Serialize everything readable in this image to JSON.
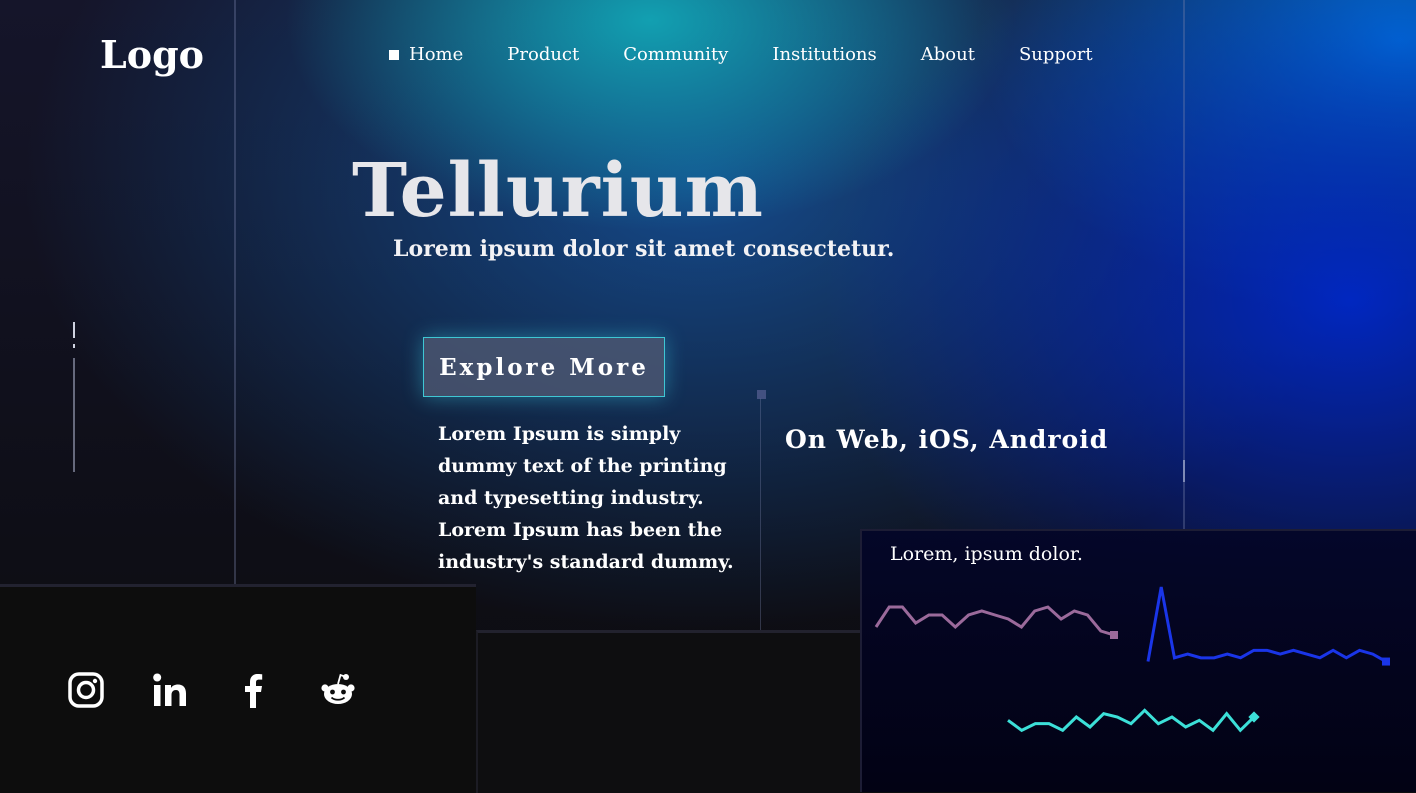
{
  "header": {
    "logo": "Logo",
    "nav": [
      "Home",
      "Product",
      "Community",
      "Institutions",
      "About",
      "Support"
    ]
  },
  "hero": {
    "title": "Tellurium",
    "subtitle": "Lorem ipsum dolor sit amet consectetur.",
    "cta_label": "Explore More",
    "description": "Lorem Ipsum is simply dummy text of the printing and typesetting industry. Lorem Ipsum has been the industry's standard dummy.",
    "platforms": "On Web, iOS, Android"
  },
  "social": [
    {
      "icon": "instagram-icon"
    },
    {
      "icon": "linkedin-icon"
    },
    {
      "icon": "facebook-icon"
    },
    {
      "icon": "reddit-icon"
    }
  ],
  "chart_data": {
    "type": "line",
    "title": "Lorem, ipsum dolor.",
    "series": [
      {
        "color": "#9b6a9b",
        "values": [
          3,
          8,
          8,
          4,
          6,
          6,
          3,
          6,
          7,
          6,
          5,
          3,
          7,
          8,
          5,
          7,
          6,
          2,
          1
        ]
      },
      {
        "color": "#1a35e8",
        "values": [
          2,
          22,
          3,
          4,
          3,
          3,
          4,
          3,
          5,
          5,
          4,
          5,
          4,
          3,
          5,
          3,
          5,
          4,
          2
        ]
      },
      {
        "color": "#3ce0d8",
        "values": [
          5,
          2,
          4,
          4,
          2,
          6,
          3,
          7,
          6,
          4,
          8,
          4,
          6,
          3,
          5,
          2,
          7,
          2,
          6
        ]
      }
    ]
  },
  "colors": {
    "accent": "#3fc7d4",
    "line1": "#9b6a9b",
    "line2": "#1a35e8",
    "line3": "#3ce0d8"
  }
}
